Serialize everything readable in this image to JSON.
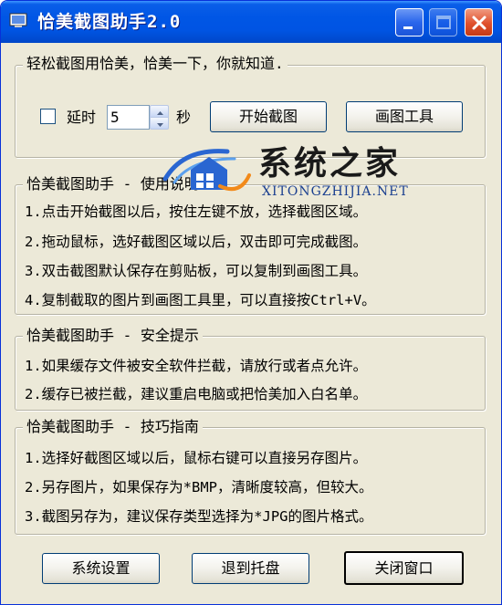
{
  "window": {
    "title": "恰美截图助手2.0"
  },
  "top_group": {
    "caption": "轻松截图用恰美，恰美一下，你就知道.",
    "delay_label": "延时",
    "delay_value": "5",
    "seconds_label": "秒",
    "start_capture_label": "开始截图",
    "draw_tool_label": "画图工具",
    "delay_checked": false
  },
  "usage_group": {
    "legend": "恰美截图助手 - 使用说明",
    "lines": [
      "1.点击开始截图以后，按住左键不放，选择截图区域。",
      "2.拖动鼠标，选好截图区域以后，双击即可完成截图。",
      "3.双击截图默认保存在剪贴板，可以复制到画图工具。",
      "4.复制截取的图片到画图工具里，可以直接按Ctrl+V。"
    ]
  },
  "safety_group": {
    "legend": "恰美截图助手 - 安全提示",
    "lines": [
      "1.如果缓存文件被安全软件拦截，请放行或者点允许。",
      "2.缓存已被拦截，建议重启电脑或把恰美加入白名单。"
    ]
  },
  "tips_group": {
    "legend": "恰美截图助手 - 技巧指南",
    "lines": [
      "1.选择好截图区域以后，鼠标右键可以直接另存图片。",
      "2.另存图片，如果保存为*BMP，清晰度较高，但较大。",
      "3.截图另存为，建议保存类型选择为*JPG的图片格式。"
    ]
  },
  "bottom_buttons": {
    "settings_label": "系统设置",
    "tray_label": "退到托盘",
    "close_label": "关闭窗口"
  },
  "watermark": {
    "cn": "系统之家",
    "en": "XITONGZHIJIA.NET"
  },
  "colors": {
    "titlebar": "#0054e3",
    "window_bg": "#ece9d8",
    "close_button": "#e0502c"
  }
}
